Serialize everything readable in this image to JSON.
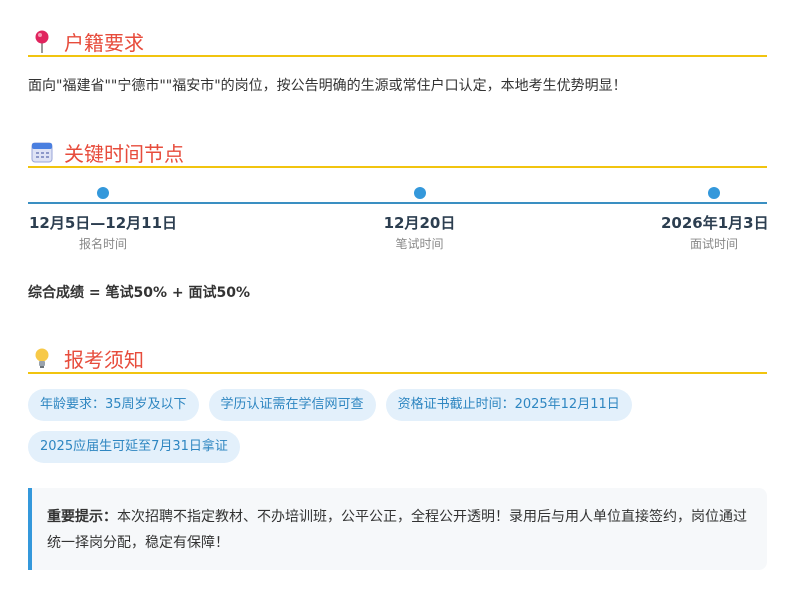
{
  "sections": {
    "household": {
      "icon": "pushpin-icon",
      "title": "户籍要求",
      "text": "面向\"福建省\"\"宁德市\"\"福安市\"的岗位，按公告明确的生源或常住户口认定，本地考生优势明显！"
    },
    "timeline": {
      "icon": "calendar-icon",
      "title": "关键时间节点",
      "items": [
        {
          "date": "12月5日—12月11日",
          "label": "报名时间"
        },
        {
          "date": "12月20日",
          "label": "笔试时间"
        },
        {
          "date": "2026年1月3日",
          "label": "面试时间"
        }
      ],
      "score": "综合成绩 = 笔试50% + 面试50%"
    },
    "notice": {
      "icon": "lightbulb-icon",
      "title": "报考须知",
      "tags": [
        "年龄要求：35周岁及以下",
        "学历认证需在学信网可查",
        "资格证书截止时间：2025年12月11日",
        "2025应届生可延至7月31日拿证"
      ],
      "tip_label": "重要提示：",
      "tip_text": "本次招聘不指定教材、不办培训班，公平公正，全程公开透明！录用后与用人单位直接签约，岗位通过统一择岗分配，稳定有保障！"
    }
  },
  "colors": {
    "heading": "#e74c3c",
    "rule": "#f1c40f",
    "accent": "#3498db",
    "tag_bg": "#e3f0fb"
  }
}
